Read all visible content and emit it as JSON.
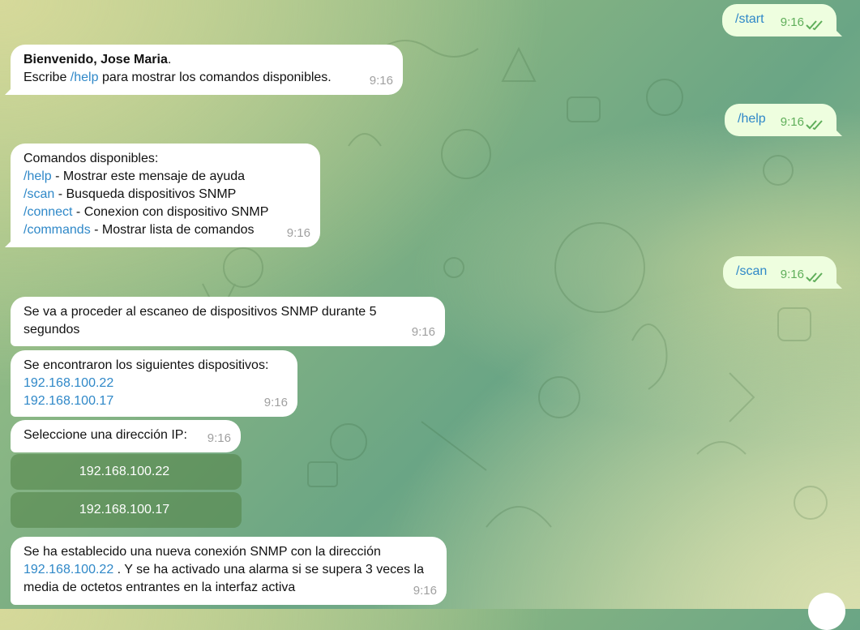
{
  "messages": {
    "m1": {
      "text": "/start",
      "time": "9:16"
    },
    "m2": {
      "name": "Bienvenido, Jose Maria",
      "period": ".",
      "pre": "Escribe ",
      "link": "/help",
      "post": " para mostrar los comandos disponibles.",
      "time": "9:16"
    },
    "m3": {
      "text": "/help",
      "time": "9:16"
    },
    "m4": {
      "title": "Comandos disponibles:",
      "commands": [
        {
          "cmd": "/help",
          "desc": " - Mostrar este mensaje de ayuda"
        },
        {
          "cmd": "/scan",
          "desc": " - Busqueda dispositivos SNMP"
        },
        {
          "cmd": "/connect",
          "desc": " - Conexion con dispositivo SNMP"
        },
        {
          "cmd": "/commands",
          "desc": " - Mostrar lista de comandos"
        }
      ],
      "time": "9:16"
    },
    "m5": {
      "text": "/scan",
      "time": "9:16"
    },
    "m6": {
      "line1": "Se va a proceder al escaneo de dispositivos SNMP durante 5",
      "line2": "segundos",
      "time": "9:16"
    },
    "m7": {
      "title": "Se encontraron los siguientes dispositivos:",
      "ip1": "192.168.100.22",
      "ip2": "192.168.100.17",
      "time": "9:16"
    },
    "m8": {
      "text": "Seleccione una dirección IP:",
      "time": "9:16"
    },
    "m9": {
      "line1": "Se ha establecido una nueva conexión SNMP con la dirección",
      "ip": "192.168.100.22",
      "line2_rest": " . Y se ha activado una alarma si se supera 3 veces la",
      "line3": "media de octetos entrantes en la interfaz activa",
      "time": "9:16"
    }
  },
  "keyboard": {
    "buttons": [
      "192.168.100.22",
      "192.168.100.17"
    ]
  },
  "colors": {
    "link": "#2f88c8",
    "outgoing_bubble": "#eefedf",
    "incoming_bubble": "#ffffff",
    "read_check": "#5fae5a"
  },
  "icons": {
    "read_receipt": "double-check-icon"
  }
}
